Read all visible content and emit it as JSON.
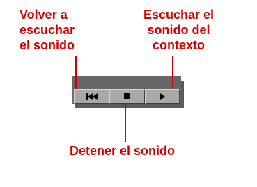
{
  "colors": {
    "callout_text": "#d40000",
    "pointer_line": "#d40000",
    "player_body": "#6e6e6e",
    "button_face": "#a8a8a8",
    "icon": "#000000"
  },
  "callouts": {
    "replay": {
      "lines": [
        "Volver a",
        "escuchar",
        "el sonido"
      ]
    },
    "context": {
      "lines": [
        "Escuchar el",
        "sonido del",
        "contexto"
      ]
    },
    "stop": {
      "lines": [
        "Detener el sonido"
      ]
    }
  },
  "player": {
    "buttons": [
      {
        "id": "replay",
        "icon": "skip-back-icon"
      },
      {
        "id": "stop",
        "icon": "stop-icon"
      },
      {
        "id": "play",
        "icon": "play-icon"
      }
    ]
  }
}
